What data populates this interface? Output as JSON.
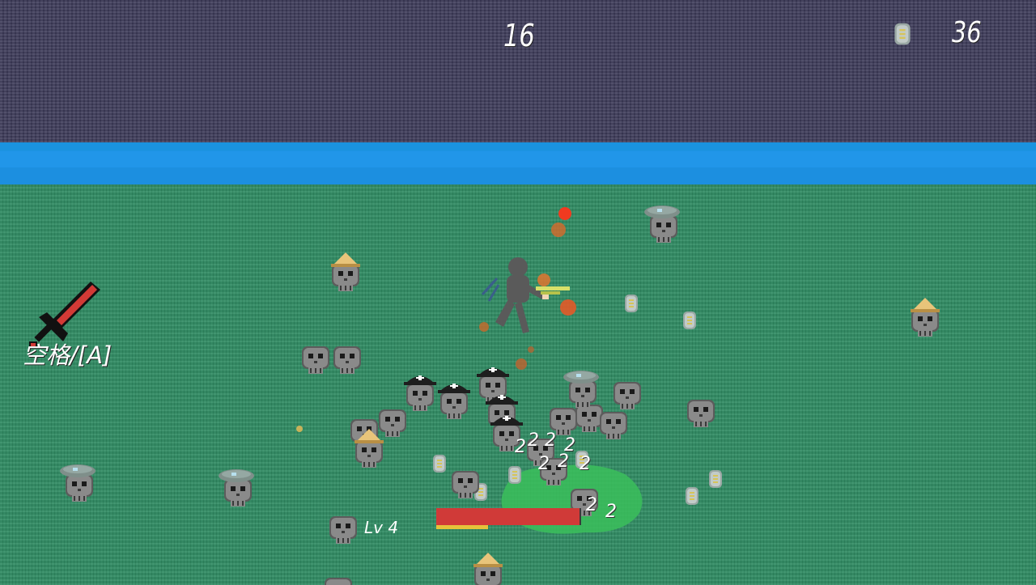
{
  "hud": {
    "timer": "16",
    "coin_count": "36",
    "coin_icon": "coin-icon",
    "weapon_icon": "red-sword-icon",
    "weapon_key": "空格/[A]"
  },
  "player": {
    "level_label": "Lv  4",
    "health_fraction": 0.99,
    "xp_fraction": 0.36
  },
  "damage_numbers": [
    "2",
    "2",
    "2",
    "2",
    "2",
    "2",
    "2",
    "2",
    "2"
  ],
  "enemies": [
    "skull-enemy",
    "skull-straw-hat-enemy",
    "skull-pirate-enemy",
    "skull-beret-enemy"
  ],
  "colors": {
    "void": "#3d3b5a",
    "water": "#2196e9",
    "grass": "#2f8b62",
    "health": "#d03a38",
    "xp": "#e6c23a"
  }
}
